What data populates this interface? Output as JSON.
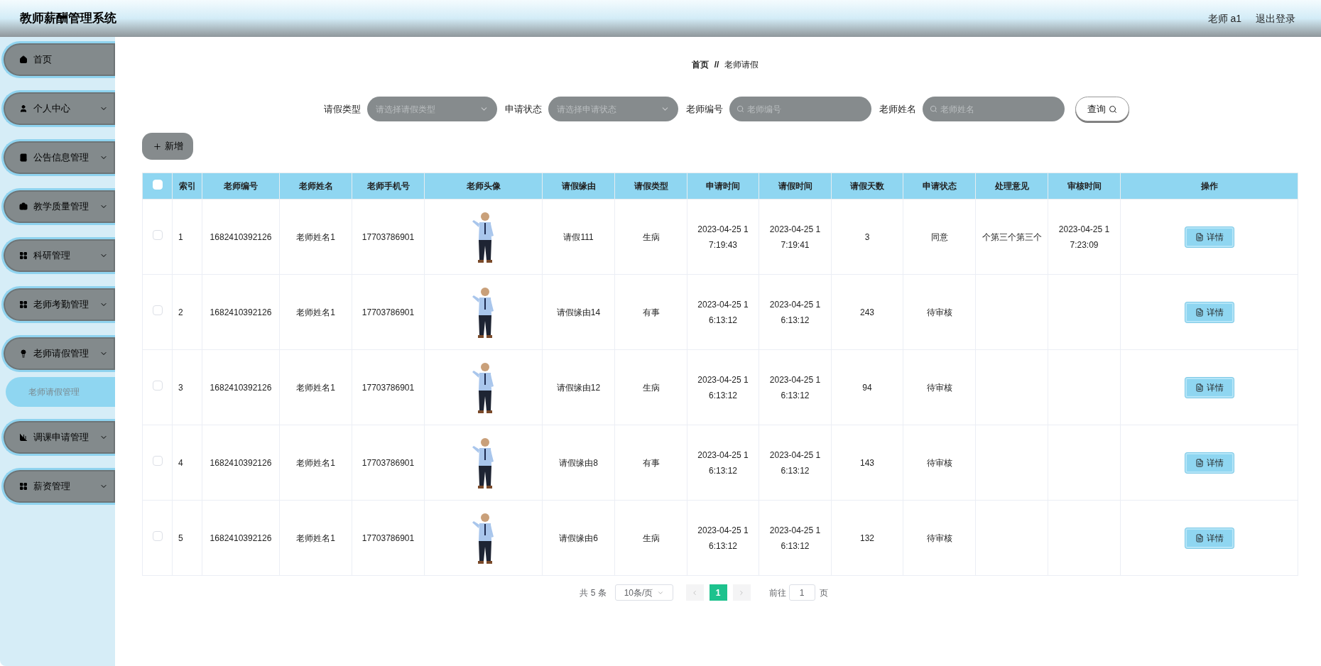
{
  "header": {
    "title": "教师薪酬管理系统",
    "user": "老师 a1",
    "logout": "退出登录"
  },
  "sidebar": {
    "items": [
      {
        "label": "首页",
        "kind": "link"
      },
      {
        "label": "个人中心",
        "kind": "menu"
      },
      {
        "label": "公告信息管理",
        "kind": "menu"
      },
      {
        "label": "教学质量管理",
        "kind": "menu"
      },
      {
        "label": "科研管理",
        "kind": "menu"
      },
      {
        "label": "老师考勤管理",
        "kind": "menu"
      },
      {
        "label": "老师请假管理",
        "kind": "menu",
        "children": [
          {
            "label": "老师请假管理",
            "selected": true
          }
        ]
      },
      {
        "label": "调课申请管理",
        "kind": "menu"
      },
      {
        "label": "薪资管理",
        "kind": "menu"
      }
    ]
  },
  "breadcrumb": [
    "首页",
    "老师请假"
  ],
  "breadcrumb_separator": "//",
  "filters": [
    {
      "label": "请假类型",
      "kind": "select",
      "placeholder": "请选择请假类型"
    },
    {
      "label": "申请状态",
      "kind": "select",
      "placeholder": "请选择申请状态"
    },
    {
      "label": "老师编号",
      "kind": "search",
      "placeholder": "老师编号"
    },
    {
      "label": "老师姓名",
      "kind": "search",
      "placeholder": "老师姓名"
    }
  ],
  "query_button": "查询",
  "add_button": "新增",
  "table": {
    "select_all": false,
    "columns": [
      "索引",
      "老师编号",
      "老师姓名",
      "老师手机号",
      "老师头像",
      "请假缘由",
      "请假类型",
      "申请时间",
      "请假时间",
      "请假天数",
      "申请状态",
      "处理意见",
      "审核时间",
      "操作"
    ],
    "rows": [
      {
        "checked": false,
        "index": "1",
        "teacher_no": "1682410392126",
        "name": "老师姓名1",
        "phone": "17703786901",
        "reason": "请假111",
        "type": "生病",
        "apply_time": "2023-04-25 17:19:43",
        "leave_time": "2023-04-25 17:19:41",
        "days": "3",
        "status": "同意",
        "opinion": "个第三个第三个",
        "review_time": "2023-04-25 17:23:09",
        "action": "详情"
      },
      {
        "checked": false,
        "index": "2",
        "teacher_no": "1682410392126",
        "name": "老师姓名1",
        "phone": "17703786901",
        "reason": "请假缘由14",
        "type": "有事",
        "apply_time": "2023-04-25 16:13:12",
        "leave_time": "2023-04-25 16:13:12",
        "days": "243",
        "status": "待审核",
        "action": "详情"
      },
      {
        "checked": false,
        "index": "3",
        "teacher_no": "1682410392126",
        "name": "老师姓名1",
        "phone": "17703786901",
        "reason": "请假缘由12",
        "type": "生病",
        "apply_time": "2023-04-25 16:13:12",
        "leave_time": "2023-04-25 16:13:12",
        "days": "94",
        "status": "待审核",
        "action": "详情"
      },
      {
        "checked": false,
        "index": "4",
        "teacher_no": "1682410392126",
        "name": "老师姓名1",
        "phone": "17703786901",
        "reason": "请假缘由8",
        "type": "有事",
        "apply_time": "2023-04-25 16:13:12",
        "leave_time": "2023-04-25 16:13:12",
        "days": "143",
        "status": "待审核",
        "action": "详情"
      },
      {
        "checked": false,
        "index": "5",
        "teacher_no": "1682410392126",
        "name": "老师姓名1",
        "phone": "17703786901",
        "reason": "请假缘由6",
        "type": "生病",
        "apply_time": "2023-04-25 16:13:12",
        "leave_time": "2023-04-25 16:13:12",
        "days": "132",
        "status": "待审核",
        "action": "详情"
      }
    ]
  },
  "pagination": {
    "total": "共 5 条",
    "page_size": "10条/页",
    "pages": [
      {
        "label": "1",
        "selected": true
      }
    ],
    "goto_label": "前往",
    "goto_value": "1",
    "page_unit": "页"
  }
}
